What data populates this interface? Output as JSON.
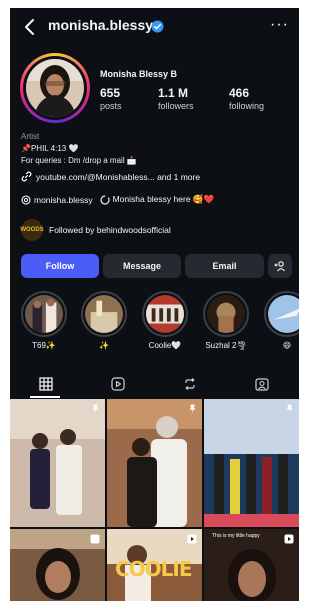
{
  "header": {
    "username": "monisha.blessy",
    "verified_color": "#3897f0",
    "back_icon": "chevron-left-icon",
    "more_icon": "more-horizontal-icon",
    "more_label": "···"
  },
  "profile": {
    "full_name": "Monisha Blessy B",
    "stats": [
      {
        "value": "655",
        "label": "posts"
      },
      {
        "value": "1.1 M",
        "label": "followers"
      },
      {
        "value": "466",
        "label": "following"
      }
    ],
    "category": "Artist",
    "bio_line1": "📌PHIL 4:13 🤍",
    "bio_line2": "For queries : Dm /drop a mail 📩",
    "link_text": "youtube.com/@Monishabless...",
    "link_more": " and 1 more",
    "threads_handle": "monisha.blessy",
    "threads_note": "Monisha blessy here 🥰❤️",
    "followed_by_prefix": "Followed by ",
    "followed_by_account": "behindwoodsofficial",
    "followed_badge_text": "WOODS"
  },
  "actions": {
    "follow_label": "Follow",
    "message_label": "Message",
    "email_label": "Email",
    "add_person_icon": "add-person-icon",
    "add_person_label": "+👤",
    "follow_color": "#4a5df9"
  },
  "highlights": [
    {
      "label": "T69✨"
    },
    {
      "label": "✨"
    },
    {
      "label": "Coolie🤍"
    },
    {
      "label": "Suzhal 2🌪"
    },
    {
      "label": "😄"
    }
  ],
  "tabs": [
    {
      "icon": "grid-icon",
      "active": true
    },
    {
      "icon": "reels-icon",
      "active": false
    },
    {
      "icon": "reposts-icon",
      "active": false
    },
    {
      "icon": "tagged-icon",
      "active": false
    }
  ],
  "grid_overlay": {
    "cell5_text": "COOLIE",
    "cell6_text": "This is my little happy"
  }
}
